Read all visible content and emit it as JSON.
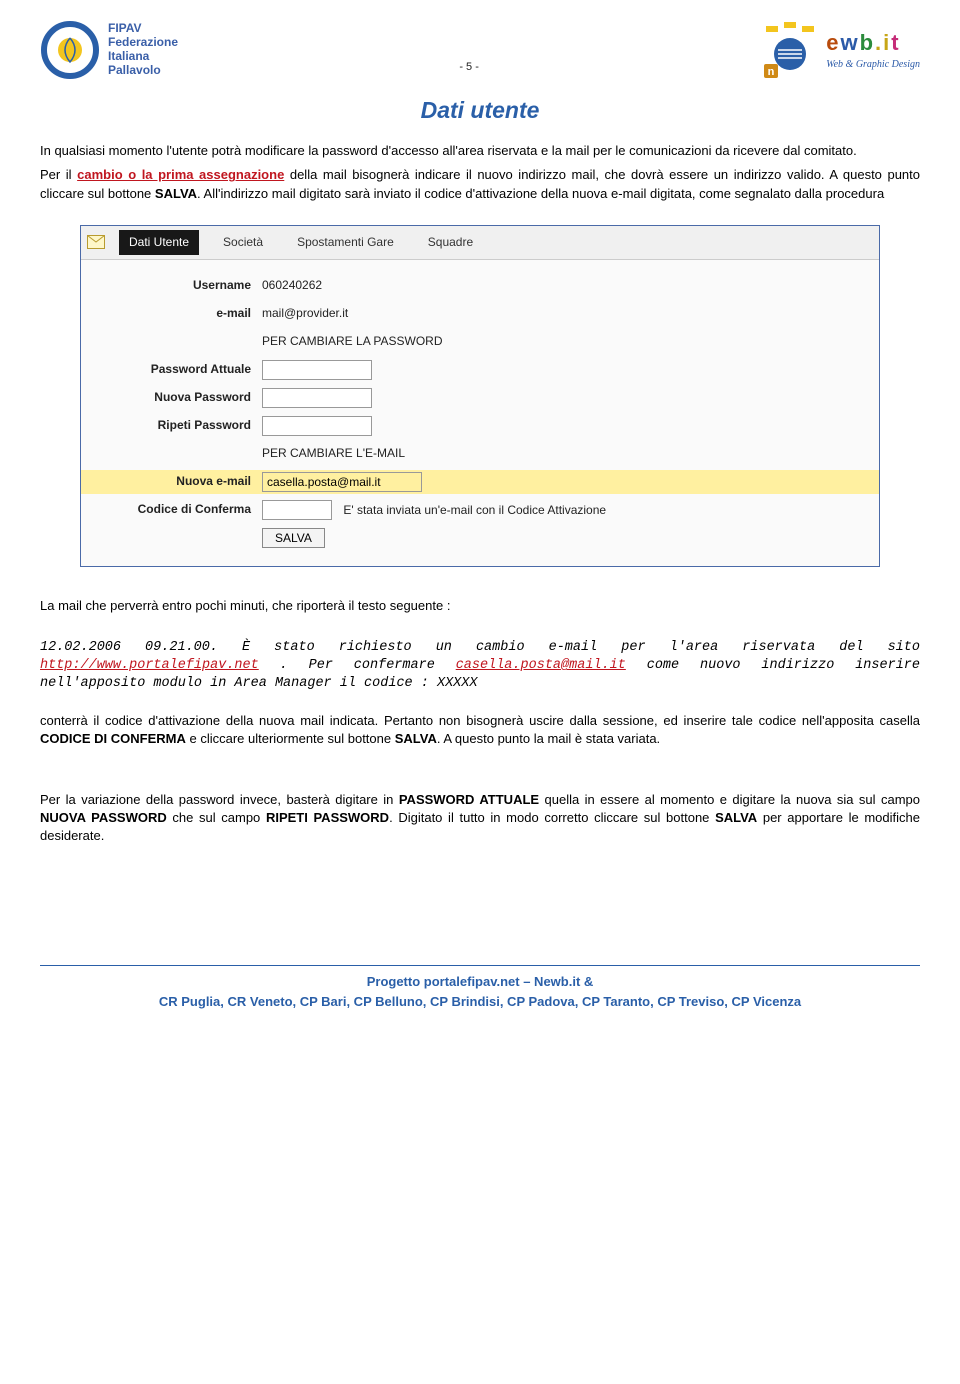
{
  "header": {
    "fipav_lines": [
      "FIPAV",
      "Federazione",
      "Italiana",
      "Pallavolo"
    ],
    "page_number": "- 5 -",
    "newb_brand_letters": {
      "e": "e",
      "w": "w",
      "b": "b",
      "dot": ".",
      "i": "i",
      "t": "t"
    },
    "newb_tagline": "Web & Graphic Design"
  },
  "title": "Dati utente",
  "intro": {
    "p1_a": "In qualsiasi momento l'utente potrà modificare la password d'accesso all'area riservata e la mail per le comunicazioni da ricevere dal comitato.",
    "p2_prefix": "Per il ",
    "p2_red": "cambio o la prima assegnazione",
    "p2_mid": " della mail bisognerà indicare il nuovo indirizzo mail, che dovrà essere un indirizzo valido. A questo punto cliccare sul bottone ",
    "p2_bold": "SALVA",
    "p2_tail": ". All'indirizzo mail digitato sarà inviato il codice d'attivazione della nuova e-mail digitata, come segnalato dalla procedura"
  },
  "screenshot": {
    "tabs": [
      "Dati Utente",
      "Società",
      "Spostamenti Gare",
      "Squadre"
    ],
    "rows": {
      "username_label": "Username",
      "username_value": "060240262",
      "email_label": "e-mail",
      "email_value": "mail@provider.it",
      "sep1": "PER CAMBIARE LA PASSWORD",
      "pwd_current_label": "Password Attuale",
      "pwd_new_label": "Nuova Password",
      "pwd_repeat_label": "Ripeti Password",
      "sep2": "PER CAMBIARE L'E-MAIL",
      "new_email_label": "Nuova e-mail",
      "new_email_value": "casella.posta@mail.it",
      "confirm_label": "Codice di Conferma",
      "confirm_hint": "E' stata inviata un'e-mail con il Codice Attivazione",
      "save_button": "SALVA"
    }
  },
  "after": {
    "lead": "La mail che perverrà entro pochi minuti, che riporterà il testo seguente :",
    "mono_head": "12.02.2006 09.21.00. È stato richiesto un cambio e-mail per l'area riservata del sito ",
    "mono_link1": "http://www.portalefipav.net",
    "mono_mid": " . Per confermare ",
    "mono_link2": "casella.posta@mail.it",
    "mono_tail": " come nuovo indirizzo inserire nell'apposito modulo in Area Manager il codice : XXXXX",
    "p3_a": "conterrà il codice d'attivazione della nuova mail indicata. Pertanto non bisognerà uscire dalla sessione, ed inserire tale codice nell'apposita casella ",
    "p3_b1": "CODICE DI CONFERMA",
    "p3_c": " e cliccare ulteriormente sul bottone ",
    "p3_b2": "SALVA",
    "p3_d": ". A questo punto la mail è stata variata.",
    "p4_a": "Per la variazione della password invece, basterà digitare in ",
    "p4_b1": "PASSWORD ATTUALE",
    "p4_c": " quella in essere al momento e digitare la nuova sia sul campo ",
    "p4_b2": "NUOVA PASSWORD",
    "p4_d": " che sul campo ",
    "p4_b3": "RIPETI PASSWORD",
    "p4_e": ". Digitato il tutto in modo corretto cliccare sul bottone ",
    "p4_b4": "SALVA",
    "p4_f": " per apportare le modifiche desiderate."
  },
  "footer": {
    "line1": "Progetto portalefipav.net – Newb.it &",
    "line2": "CR Puglia, CR Veneto, CP Bari, CP Belluno, CP Brindisi, CP Padova, CP Taranto, CP Treviso, CP Vicenza"
  }
}
